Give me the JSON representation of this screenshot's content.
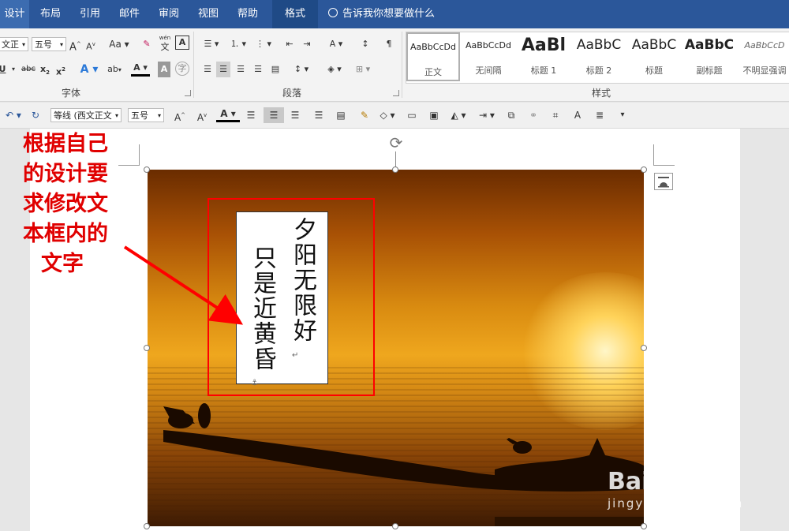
{
  "tabs": [
    {
      "label": "设计",
      "active": true
    },
    {
      "label": "布局"
    },
    {
      "label": "引用"
    },
    {
      "label": "邮件"
    },
    {
      "label": "审阅"
    },
    {
      "label": "视图"
    },
    {
      "label": "帮助"
    },
    {
      "label": "格式",
      "contextual": true
    }
  ],
  "tell_me": "告诉我你想要做什么",
  "ribbon": {
    "font": {
      "font_name": "文正",
      "font_size": "五号",
      "group_label": "字体",
      "wen_label": "wén",
      "wen_char": "文",
      "a_box": "A",
      "aa": "Aa"
    },
    "paragraph": {
      "group_label": "段落"
    },
    "styles": {
      "group_label": "样式",
      "items": [
        {
          "sample": "AaBbCcDd",
          "name": "正文"
        },
        {
          "sample": "AaBbCcDd",
          "name": "无间隔"
        },
        {
          "sample": "AaBl",
          "name": "标题 1"
        },
        {
          "sample": "AaBbC",
          "name": "标题 2"
        },
        {
          "sample": "AaBbC",
          "name": "标题"
        },
        {
          "sample": "AaBbC",
          "name": "副标题"
        },
        {
          "sample": "AaBbCcD",
          "name": "不明显强调"
        }
      ]
    }
  },
  "minibar": {
    "font_name": "等线 (西文正文",
    "font_size": "五号"
  },
  "document": {
    "textbox_col_right": "夕阳无限好",
    "textbox_col_left": "只是近黄昏"
  },
  "annotation": {
    "lines": [
      "根据自己",
      "的设计要",
      "求修改文",
      "本框内的",
      "文字"
    ]
  },
  "watermark": {
    "brand": "Bai度经验",
    "url": "jingyan.baidu.com"
  },
  "colors": {
    "tab_bar": "#2b579a",
    "annotation_red": "#ff0000"
  }
}
